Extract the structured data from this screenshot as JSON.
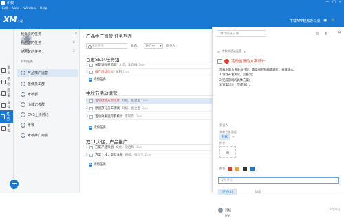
{
  "window": {
    "app_name": "少校",
    "buttons": [
      "—",
      "□",
      "✕"
    ]
  },
  "menu": {
    "items": [
      "Edit",
      "View",
      "Window",
      "Help"
    ]
  },
  "topbar": {
    "logo": "XM",
    "logo_sub": "小秘",
    "download": "下载APP轻松办公桌"
  },
  "rail": [
    {
      "label": "消息",
      "icon": "bell-icon"
    },
    {
      "label": "群组",
      "icon": "group-icon"
    },
    {
      "label": "同事",
      "icon": "contacts-icon"
    },
    {
      "label": "文件",
      "icon": "file-icon"
    },
    {
      "label": "任务",
      "icon": "task-icon",
      "active": true
    },
    {
      "label": "审批",
      "icon": "approval-icon"
    }
  ],
  "profile": {
    "name": "刘斌"
  },
  "nav": {
    "my_tasks": [
      {
        "label": "我负责的任务",
        "count": "10"
      },
      {
        "label": "我创建的任务",
        "count": "6"
      },
      {
        "label": "待验证的任务",
        "count": "2"
      }
    ],
    "project_section": "群组任务",
    "projects": [
      {
        "label": "产品推广运营",
        "active": true
      },
      {
        "label": "金体员工群"
      },
      {
        "label": "考核部"
      },
      {
        "label": "小城记者群"
      },
      {
        "label": "EMS上线讨论"
      },
      {
        "label": "考核"
      },
      {
        "label": "考核推广商会"
      }
    ]
  },
  "main": {
    "title": "产品推广运营 任务列表",
    "search_placeholder": "搜索任务",
    "status_label": "状态：",
    "status_value": "进行中",
    "owner_label": "负责人：",
    "groups": [
      {
        "title": "百度SEM任务组",
        "tasks": [
          {
            "num": "1",
            "title": "关键词效果追踪",
            "owner": "文虎，沈启梅",
            "due": "Due",
            "red": false
          },
          {
            "num": "2",
            "title": "推广后续优化",
            "owner": "吴利",
            "due": "Due",
            "red": true
          }
        ]
      },
      {
        "title": "中秋节活动运营",
        "tasks": [
          {
            "num": "1",
            "title": "活动创意方案设计",
            "owner": "刘斌，张立宝",
            "due": "Due",
            "red": true,
            "selected": true
          },
          {
            "num": "2",
            "title": "原创部分员工测试",
            "owner": "刘斌，张立宝",
            "due": "Due",
            "red": false
          },
          {
            "num": "3",
            "title": "活动效果追踪及统计",
            "owner": "李知音",
            "due": "Due",
            "red": false
          }
        ]
      },
      {
        "title": "双11大促，产品推广",
        "tasks": [
          {
            "num": "1",
            "title": "方案产品策划",
            "owner": "文虎，沈启梅",
            "due": "Due",
            "red": false
          },
          {
            "num": "2",
            "title": "方案上线，资料准备",
            "owner": "刘斌，张立宝",
            "due": "Due",
            "red": false
          }
        ]
      }
    ],
    "add_task_label": "添加任务"
  },
  "detail": {
    "search_placeholder": "预计完成日期",
    "breadcrumb": "中秋节活动运营",
    "title": "活动创意的方案设计",
    "description": [
      "游戏主题为五毛与月饼，需电商老师和铁路区，推荐版本。",
      "1.游戏开发测试，完整流；",
      "2.完成游戏的具体方案；",
      "3.方案讨论，完成设计。"
    ],
    "owner_label": "负责人",
    "tags_label": "关联任务验证",
    "tags": [
      "刘斌"
    ],
    "attach_label": "附件",
    "color_label": "颜色",
    "colors": [
      "#d8402f",
      "#e6a23c",
      "#333333",
      "#1a7ad3"
    ],
    "comment_placeholder": "发布评论",
    "tabs": [
      "评论(1)",
      "动态"
    ],
    "comment": {
      "user": "刘斌",
      "time": "8月23日",
      "body": "好的"
    }
  }
}
